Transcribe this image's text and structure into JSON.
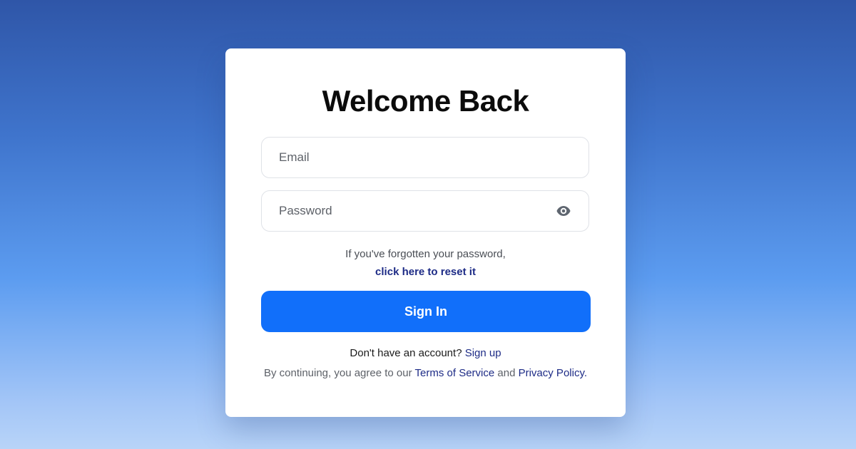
{
  "login": {
    "title": "Welcome Back",
    "email_placeholder": "Email",
    "password_placeholder": "Password",
    "toggle_visibility_icon": "eye-icon",
    "forgot_text": "If you've forgotten your password,",
    "reset_link": "click here to reset it",
    "signin_label": "Sign In",
    "signup_prompt": "Don't have an account?",
    "signup_link": "Sign up",
    "terms_prefix": "By continuing, you agree to our",
    "terms_link": "Terms of Service",
    "terms_and": "and",
    "privacy_link": "Privacy Policy",
    "terms_suffix": "."
  },
  "colors": {
    "primary_button": "#116ffa",
    "link": "#1d2b86",
    "background_top": "#2f56a8",
    "background_bottom": "#b8d4f8"
  }
}
